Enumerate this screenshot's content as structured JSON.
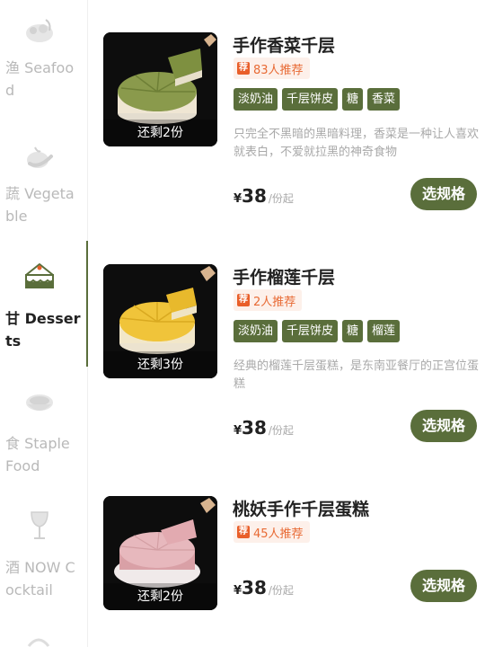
{
  "sidebar": {
    "categories": [
      {
        "label": "渔 Seafood",
        "icon": "seafood-icon",
        "active": false
      },
      {
        "label": "蔬 Vegetable",
        "icon": "vegetable-icon",
        "active": false
      },
      {
        "label": "甘 Desserts",
        "icon": "cake-icon",
        "active": true
      },
      {
        "label": "食 Staple Food",
        "icon": "bowl-icon",
        "active": false
      },
      {
        "label": "酒 NOW Cocktail",
        "icon": "wine-glass-icon",
        "active": false
      }
    ]
  },
  "products": [
    {
      "name": "手作香菜千层",
      "stock": "还剩2份",
      "recommend": "83人推荐",
      "tags": [
        "淡奶油",
        "千层饼皮",
        "糖",
        "香菜"
      ],
      "desc": "只完全不黑暗的黑暗料理，香菜是一种让人喜欢就表白，不爱就拉黑的神奇食物",
      "currency": "¥",
      "price": "38",
      "unit": "/份起",
      "button": "选规格"
    },
    {
      "name": "手作榴莲千层",
      "stock": "还剩3份",
      "recommend": "2人推荐",
      "tags": [
        "淡奶油",
        "千层饼皮",
        "糖",
        "榴莲"
      ],
      "desc": "经典的榴莲千层蛋糕，是东南亚餐厅的正宫位蛋糕",
      "currency": "¥",
      "price": "38",
      "unit": "/份起",
      "button": "选规格"
    },
    {
      "name": "桃妖手作千层蛋糕",
      "stock": "还剩2份",
      "recommend": "45人推荐",
      "tags": [],
      "desc": "",
      "currency": "¥",
      "price": "38",
      "unit": "/份起",
      "button": "选规格"
    }
  ],
  "colors": {
    "brand": "#5a6e3b",
    "recommend_text": "#e86a34",
    "recommend_bg": "#fdf0ea",
    "muted": "#b9b9b9"
  }
}
